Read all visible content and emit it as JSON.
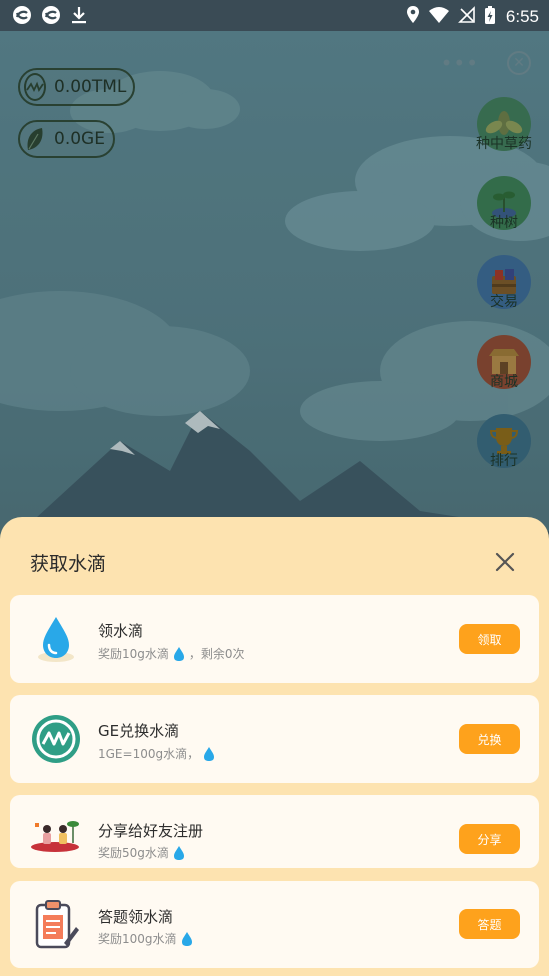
{
  "status_bar": {
    "time": "6:55"
  },
  "balances": [
    {
      "icon": "tml-coin-icon",
      "value": "0.00TML"
    },
    {
      "icon": "leaf-icon",
      "value": "0.0GE"
    }
  ],
  "side_menu": [
    {
      "label": "种中草药",
      "icon": "herb-icon"
    },
    {
      "label": "种树",
      "icon": "sapling-icon"
    },
    {
      "label": "交易",
      "icon": "trade-box-icon"
    },
    {
      "label": "商城",
      "icon": "shop-icon"
    },
    {
      "label": "排行",
      "icon": "trophy-icon"
    }
  ],
  "sheet": {
    "title": "获取水滴",
    "tasks": [
      {
        "title": "领水滴",
        "subtitle": "奖励10g水滴",
        "suffix": "，剩余0次",
        "button": "领取",
        "icon": "water-drop-icon"
      },
      {
        "title": "GE兑换水滴",
        "subtitle": "1GE=100g水滴，",
        "suffix": "",
        "button": "兑换",
        "icon": "ge-coin-icon"
      },
      {
        "title": "分享给好友注册",
        "subtitle": "奖励50g水滴",
        "suffix": "",
        "button": "分享",
        "icon": "friends-picnic-icon"
      },
      {
        "title": "答题领水滴",
        "subtitle": "奖励100g水滴",
        "suffix": "",
        "button": "答题",
        "icon": "quiz-clipboard-icon"
      }
    ]
  },
  "colors": {
    "accent_button": "#fea21c",
    "sheet_background": "#fde3b0",
    "card_background": "#fffaf2",
    "status_bar": "#3a4b55"
  }
}
